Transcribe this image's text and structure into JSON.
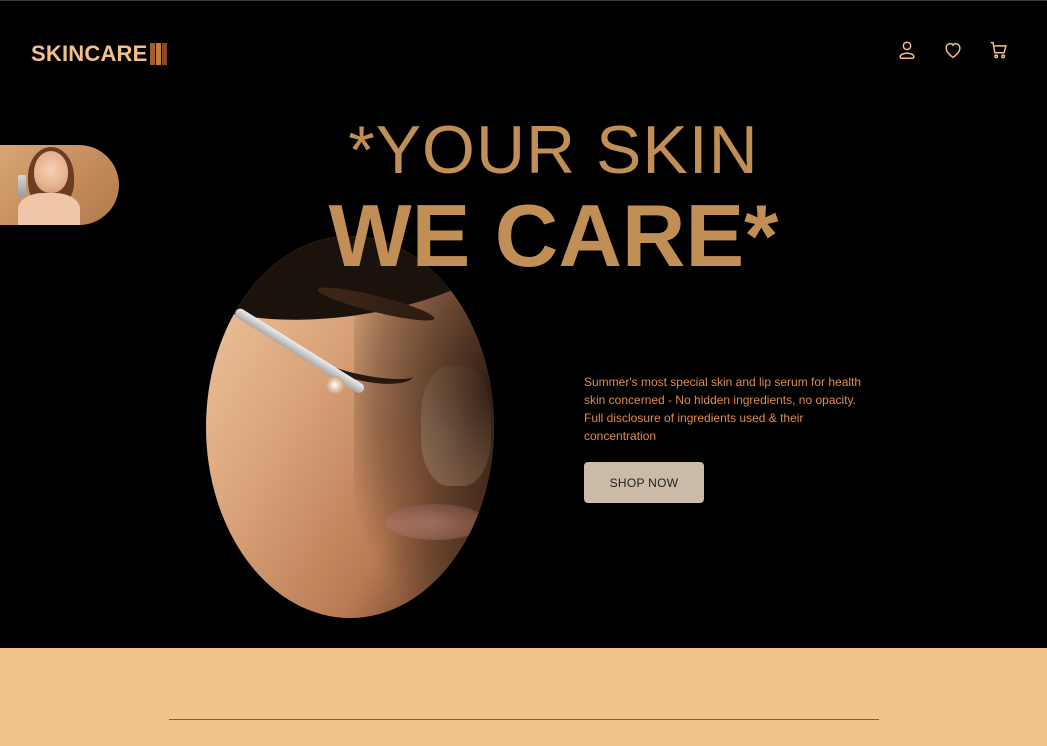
{
  "brand": {
    "name": "SKINCARE",
    "bar_colors": [
      "#a35a2c",
      "#c17a3e",
      "#8a4a24"
    ]
  },
  "header": {
    "icons": [
      "user-icon",
      "heart-icon",
      "cart-icon"
    ],
    "icon_color": "#f2c08a"
  },
  "hero": {
    "headline_line1": "*YOUR SKIN",
    "headline_line2": "WE CARE*",
    "description": "Summer's most special skin and lip serum for health skin concerned - No hidden ingredients, no opacity. Full disclosure of ingredients used & their concentration",
    "cta_label": "SHOP NOW"
  },
  "colors": {
    "background": "#000000",
    "accent_gold": "#c18f56",
    "description_text": "#e08a4a",
    "button_bg": "#cbbba6",
    "band": "#f2c48c"
  }
}
